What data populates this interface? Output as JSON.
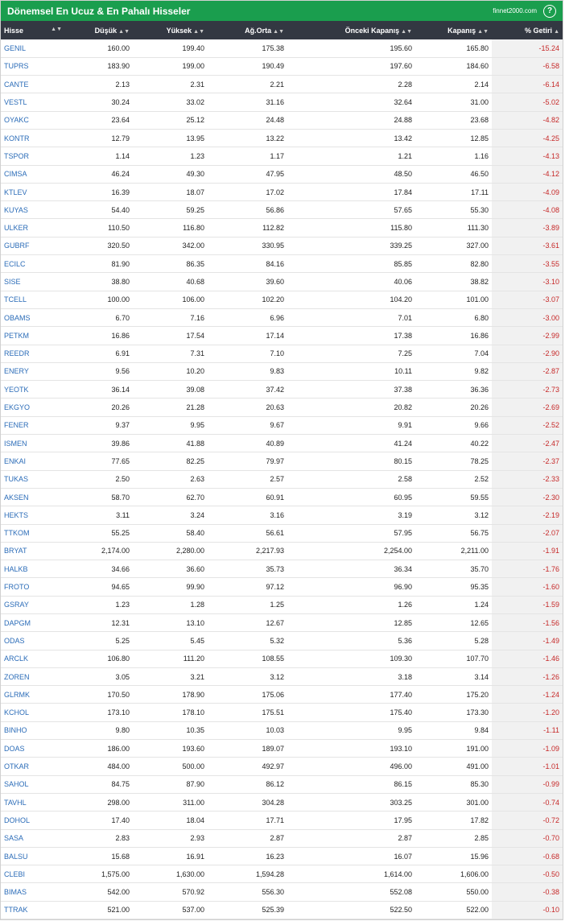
{
  "header": {
    "title": "Dönemsel En Ucuz & En Pahalı Hisseler",
    "site": "finnet2000.com",
    "help_icon": "?"
  },
  "columns": [
    "Hisse",
    "Düşük",
    "Yüksek",
    "Ağ.Orta",
    "Önceki Kapanış",
    "Kapanış",
    "% Getiri"
  ],
  "rows": [
    [
      "GENIL",
      "160.00",
      "199.40",
      "175.38",
      "195.60",
      "165.80",
      "-15.24"
    ],
    [
      "TUPRS",
      "183.90",
      "199.00",
      "190.49",
      "197.60",
      "184.60",
      "-6.58"
    ],
    [
      "CANTE",
      "2.13",
      "2.31",
      "2.21",
      "2.28",
      "2.14",
      "-6.14"
    ],
    [
      "VESTL",
      "30.24",
      "33.02",
      "31.16",
      "32.64",
      "31.00",
      "-5.02"
    ],
    [
      "OYAKC",
      "23.64",
      "25.12",
      "24.48",
      "24.88",
      "23.68",
      "-4.82"
    ],
    [
      "KONTR",
      "12.79",
      "13.95",
      "13.22",
      "13.42",
      "12.85",
      "-4.25"
    ],
    [
      "TSPOR",
      "1.14",
      "1.23",
      "1.17",
      "1.21",
      "1.16",
      "-4.13"
    ],
    [
      "CIMSA",
      "46.24",
      "49.30",
      "47.95",
      "48.50",
      "46.50",
      "-4.12"
    ],
    [
      "KTLEV",
      "16.39",
      "18.07",
      "17.02",
      "17.84",
      "17.11",
      "-4.09"
    ],
    [
      "KUYAS",
      "54.40",
      "59.25",
      "56.86",
      "57.65",
      "55.30",
      "-4.08"
    ],
    [
      "ULKER",
      "110.50",
      "116.80",
      "112.82",
      "115.80",
      "111.30",
      "-3.89"
    ],
    [
      "GUBRF",
      "320.50",
      "342.00",
      "330.95",
      "339.25",
      "327.00",
      "-3.61"
    ],
    [
      "ECILC",
      "81.90",
      "86.35",
      "84.16",
      "85.85",
      "82.80",
      "-3.55"
    ],
    [
      "SISE",
      "38.80",
      "40.68",
      "39.60",
      "40.06",
      "38.82",
      "-3.10"
    ],
    [
      "TCELL",
      "100.00",
      "106.00",
      "102.20",
      "104.20",
      "101.00",
      "-3.07"
    ],
    [
      "OBAMS",
      "6.70",
      "7.16",
      "6.96",
      "7.01",
      "6.80",
      "-3.00"
    ],
    [
      "PETKM",
      "16.86",
      "17.54",
      "17.14",
      "17.38",
      "16.86",
      "-2.99"
    ],
    [
      "REEDR",
      "6.91",
      "7.31",
      "7.10",
      "7.25",
      "7.04",
      "-2.90"
    ],
    [
      "ENERY",
      "9.56",
      "10.20",
      "9.83",
      "10.11",
      "9.82",
      "-2.87"
    ],
    [
      "YEOTK",
      "36.14",
      "39.08",
      "37.42",
      "37.38",
      "36.36",
      "-2.73"
    ],
    [
      "EKGYO",
      "20.26",
      "21.28",
      "20.63",
      "20.82",
      "20.26",
      "-2.69"
    ],
    [
      "FENER",
      "9.37",
      "9.95",
      "9.67",
      "9.91",
      "9.66",
      "-2.52"
    ],
    [
      "ISMEN",
      "39.86",
      "41.88",
      "40.89",
      "41.24",
      "40.22",
      "-2.47"
    ],
    [
      "ENKAI",
      "77.65",
      "82.25",
      "79.97",
      "80.15",
      "78.25",
      "-2.37"
    ],
    [
      "TUKAS",
      "2.50",
      "2.63",
      "2.57",
      "2.58",
      "2.52",
      "-2.33"
    ],
    [
      "AKSEN",
      "58.70",
      "62.70",
      "60.91",
      "60.95",
      "59.55",
      "-2.30"
    ],
    [
      "HEKTS",
      "3.11",
      "3.24",
      "3.16",
      "3.19",
      "3.12",
      "-2.19"
    ],
    [
      "TTKOM",
      "55.25",
      "58.40",
      "56.61",
      "57.95",
      "56.75",
      "-2.07"
    ],
    [
      "BRYAT",
      "2,174.00",
      "2,280.00",
      "2,217.93",
      "2,254.00",
      "2,211.00",
      "-1.91"
    ],
    [
      "HALKB",
      "34.66",
      "36.60",
      "35.73",
      "36.34",
      "35.70",
      "-1.76"
    ],
    [
      "FROTO",
      "94.65",
      "99.90",
      "97.12",
      "96.90",
      "95.35",
      "-1.60"
    ],
    [
      "GSRAY",
      "1.23",
      "1.28",
      "1.25",
      "1.26",
      "1.24",
      "-1.59"
    ],
    [
      "DAPGM",
      "12.31",
      "13.10",
      "12.67",
      "12.85",
      "12.65",
      "-1.56"
    ],
    [
      "ODAS",
      "5.25",
      "5.45",
      "5.32",
      "5.36",
      "5.28",
      "-1.49"
    ],
    [
      "ARCLK",
      "106.80",
      "111.20",
      "108.55",
      "109.30",
      "107.70",
      "-1.46"
    ],
    [
      "ZOREN",
      "3.05",
      "3.21",
      "3.12",
      "3.18",
      "3.14",
      "-1.26"
    ],
    [
      "GLRMK",
      "170.50",
      "178.90",
      "175.06",
      "177.40",
      "175.20",
      "-1.24"
    ],
    [
      "KCHOL",
      "173.10",
      "178.10",
      "175.51",
      "175.40",
      "173.30",
      "-1.20"
    ],
    [
      "BINHO",
      "9.80",
      "10.35",
      "10.03",
      "9.95",
      "9.84",
      "-1.11"
    ],
    [
      "DOAS",
      "186.00",
      "193.60",
      "189.07",
      "193.10",
      "191.00",
      "-1.09"
    ],
    [
      "OTKAR",
      "484.00",
      "500.00",
      "492.97",
      "496.00",
      "491.00",
      "-1.01"
    ],
    [
      "SAHOL",
      "84.75",
      "87.90",
      "86.12",
      "86.15",
      "85.30",
      "-0.99"
    ],
    [
      "TAVHL",
      "298.00",
      "311.00",
      "304.28",
      "303.25",
      "301.00",
      "-0.74"
    ],
    [
      "DOHOL",
      "17.40",
      "18.04",
      "17.71",
      "17.95",
      "17.82",
      "-0.72"
    ],
    [
      "SASA",
      "2.83",
      "2.93",
      "2.87",
      "2.87",
      "2.85",
      "-0.70"
    ],
    [
      "BALSU",
      "15.68",
      "16.91",
      "16.23",
      "16.07",
      "15.96",
      "-0.68"
    ],
    [
      "CLEBI",
      "1,575.00",
      "1,630.00",
      "1,594.28",
      "1,614.00",
      "1,606.00",
      "-0.50"
    ],
    [
      "BIMAS",
      "542.00",
      "570.92",
      "556.30",
      "552.08",
      "550.00",
      "-0.38"
    ],
    [
      "TTRAK",
      "521.00",
      "537.00",
      "525.39",
      "522.50",
      "522.00",
      "-0.10"
    ]
  ]
}
